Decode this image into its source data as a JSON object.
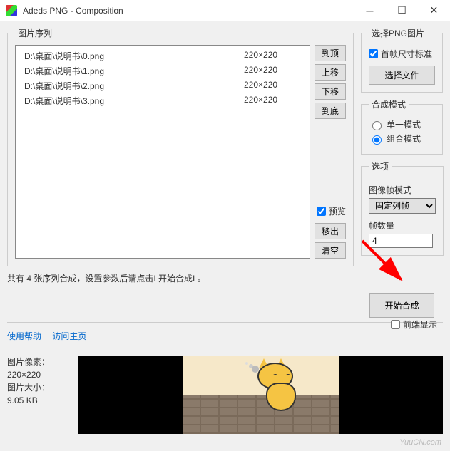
{
  "window": {
    "title": "Adeds PNG - Composition"
  },
  "sequence": {
    "legend": "图片序列",
    "items": [
      {
        "path": "D:\\桌面\\说明书\\0.png",
        "dim": "220×220"
      },
      {
        "path": "D:\\桌面\\说明书\\1.png",
        "dim": "220×220"
      },
      {
        "path": "D:\\桌面\\说明书\\2.png",
        "dim": "220×220"
      },
      {
        "path": "D:\\桌面\\说明书\\3.png",
        "dim": "220×220"
      }
    ],
    "buttons": {
      "top": "到顶",
      "up": "上移",
      "down": "下移",
      "bottom": "到底",
      "remove": "移出",
      "clear": "清空"
    },
    "preview_label": "预览",
    "summary": "共有 4 张序列合成，设置参数后请点击I  开始合成I  。"
  },
  "panel": {
    "select_png": {
      "legend": "选择PNG图片",
      "first_frame_std": "首帧尺寸标准",
      "choose_file": "选择文件"
    },
    "mode": {
      "legend": "合成模式",
      "single": "单一模式",
      "combo": "组合模式"
    },
    "options": {
      "legend": "选项",
      "frame_mode_label": "图像帧模式",
      "frame_mode_value": "固定列帧",
      "frame_count_label": "帧数量",
      "frame_count_value": "4"
    },
    "start": "开始合成",
    "foreground": "前端显示"
  },
  "links": {
    "help": "使用帮助",
    "home": "访问主页"
  },
  "info": {
    "pixels_label": "图片像素：",
    "pixels_value": "220×220",
    "size_label": "图片大小：",
    "size_value": "9.05 KB"
  },
  "watermark": "YuuCN.com"
}
